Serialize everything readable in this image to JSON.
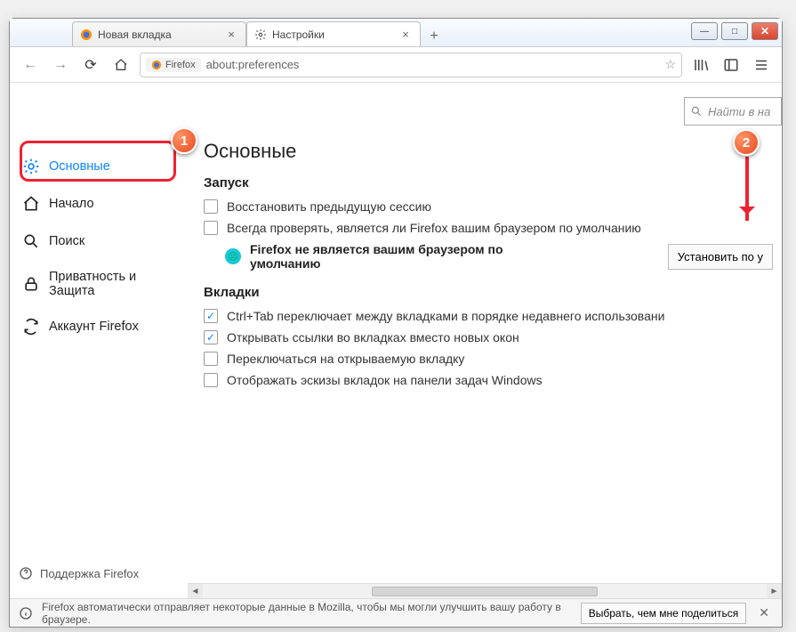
{
  "window": {
    "tabs": [
      {
        "label": "Новая вкладка",
        "active": false
      },
      {
        "label": "Настройки",
        "active": true
      }
    ]
  },
  "toolbar": {
    "brand_label": "Firefox",
    "address": "about:preferences"
  },
  "sidebar": {
    "items": [
      {
        "label": "Основные",
        "active": true,
        "icon": "gear"
      },
      {
        "label": "Начало",
        "active": false,
        "icon": "home"
      },
      {
        "label": "Поиск",
        "active": false,
        "icon": "search"
      },
      {
        "label": "Приватность и Защита",
        "active": false,
        "icon": "lock"
      },
      {
        "label": "Аккаунт Firefox",
        "active": false,
        "icon": "sync"
      }
    ],
    "support_label": "Поддержка Firefox"
  },
  "search": {
    "placeholder": "Найти в на"
  },
  "page": {
    "title": "Основные",
    "startup": {
      "heading": "Запуск",
      "restore_label": "Восстановить предыдущую сессию",
      "check_default_label": "Всегда проверять, является ли Firefox вашим браузером по умолчанию",
      "not_default_text": "Firefox не является вашим браузером по умолчанию",
      "set_default_button": "Установить по у"
    },
    "tabs": {
      "heading": "Вкладки",
      "ctrl_tab_label": "Ctrl+Tab переключает между вкладками в порядке недавнего использовани",
      "open_links_label": "Открывать ссылки во вкладках вместо новых окон",
      "switch_tab_label": "Переключаться на открываемую вкладку",
      "taskbar_preview_label": "Отображать эскизы вкладок на панели задач Windows"
    }
  },
  "infobar": {
    "text": "Firefox автоматически отправляет некоторые данные в Mozilla, чтобы мы могли улучшить вашу работу в браузере.",
    "button": "Выбрать, чем мне поделиться"
  },
  "callouts": {
    "one": "1",
    "two": "2"
  }
}
